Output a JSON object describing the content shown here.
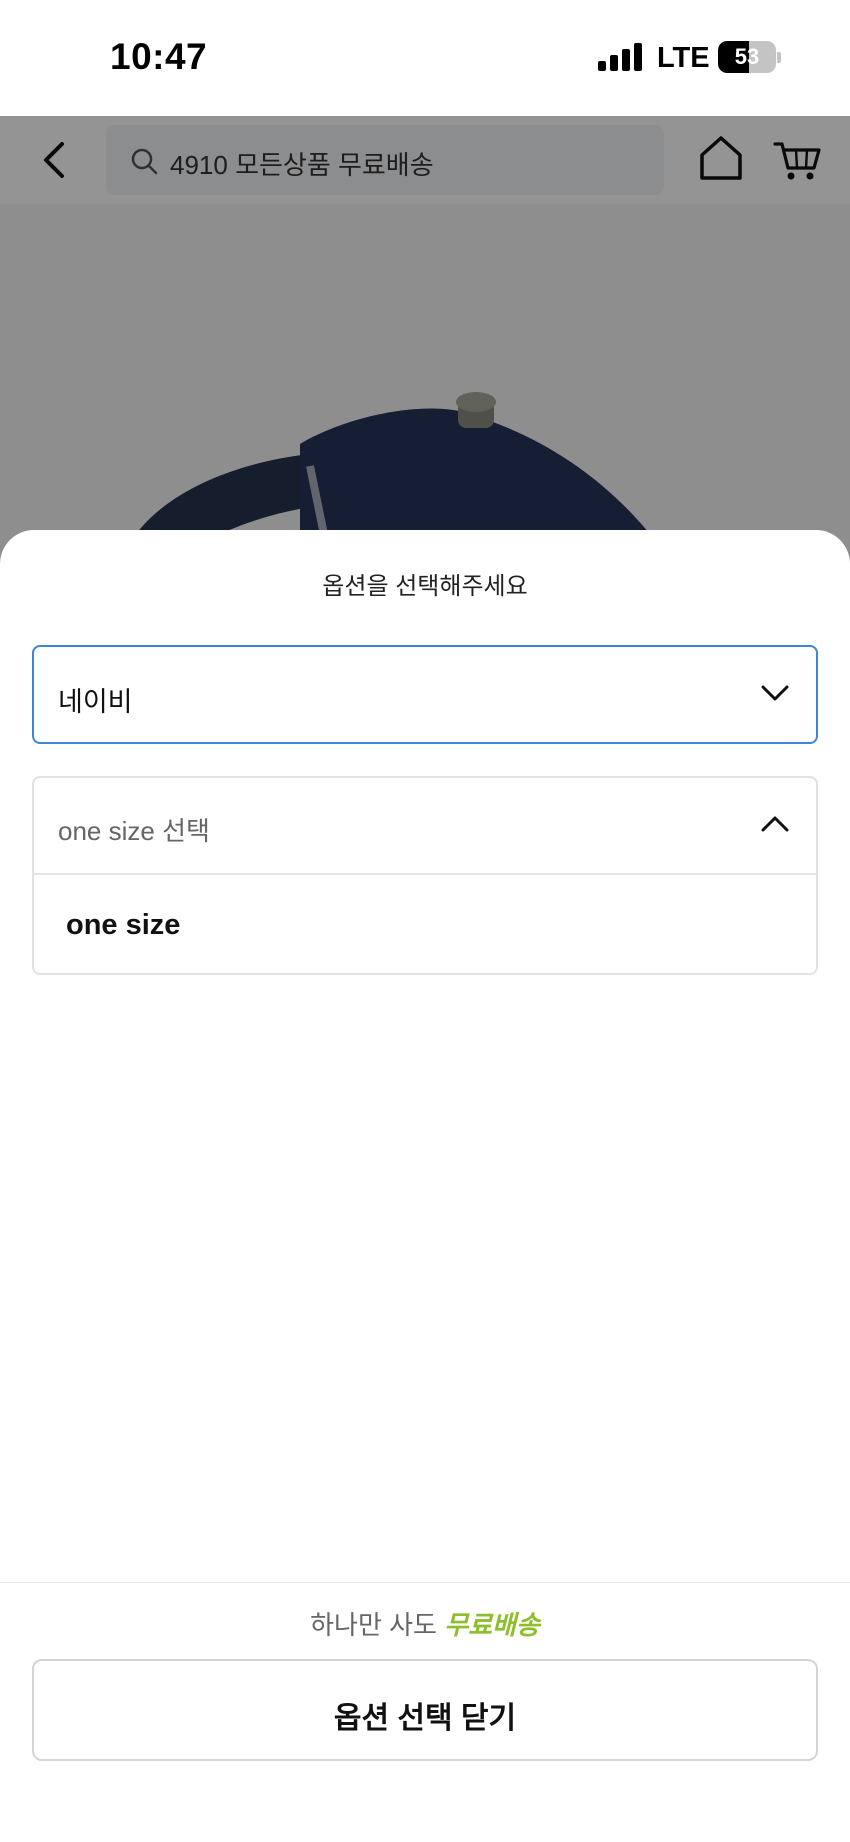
{
  "status_bar": {
    "time": "10:47",
    "network": "LTE",
    "battery_level": "53",
    "battery_fraction": 0.53
  },
  "header": {
    "search_text": "4910 모든상품 무료배송",
    "icons": [
      "back-arrow-icon",
      "search-icon",
      "home-icon",
      "cart-icon"
    ]
  },
  "sheet": {
    "title": "옵션을 선택해주세요",
    "color_select": {
      "value": "네이비",
      "icon": "chevron-down-icon"
    },
    "size_select": {
      "placeholder": "one size 선택",
      "icon": "chevron-up-icon",
      "options": [
        "one size"
      ]
    },
    "promo_prefix": "하나만 사도",
    "promo_highlight": "무료배송",
    "close_label": "옵션 선택 닫기"
  },
  "colors": {
    "accent_border": "#3c86d6",
    "promo_green": "#8dbf2c",
    "watch_navy": "#26345a"
  }
}
